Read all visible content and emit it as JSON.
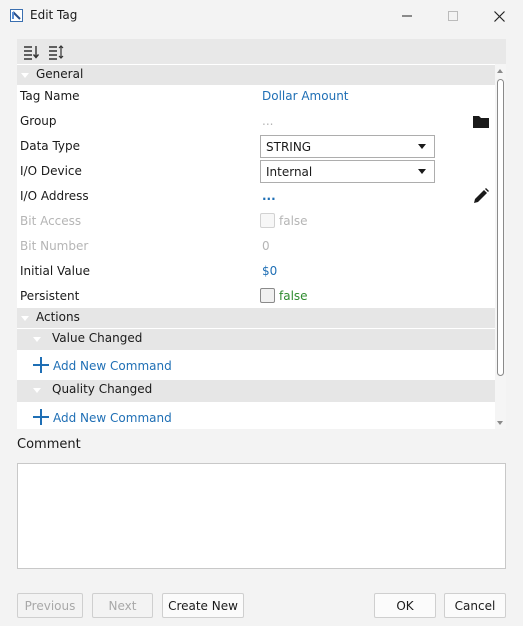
{
  "window": {
    "title": "Edit Tag"
  },
  "toolbar": {
    "icons": [
      "sort-ascending-icon",
      "sort-options-icon"
    ]
  },
  "sections": {
    "general": "General",
    "actions": "Actions",
    "value_changed": "Value Changed",
    "quality_changed": "Quality Changed"
  },
  "properties": {
    "tag_name": {
      "label": "Tag Name",
      "value": "Dollar Amount"
    },
    "group": {
      "label": "Group",
      "value": "..."
    },
    "data_type": {
      "label": "Data Type",
      "value": "STRING"
    },
    "io_device": {
      "label": "I/O Device",
      "value": "Internal"
    },
    "io_address": {
      "label": "I/O Address",
      "value": "..."
    },
    "bit_access": {
      "label": "Bit Access",
      "value": "false"
    },
    "bit_number": {
      "label": "Bit Number",
      "value": "0"
    },
    "initial_value": {
      "label": "Initial Value",
      "value": "$0"
    },
    "persistent": {
      "label": "Persistent",
      "value": "false"
    }
  },
  "actions": {
    "value_changed_add": "Add New Command",
    "quality_changed_add": "Add New Command"
  },
  "comment": {
    "label": "Comment",
    "value": ""
  },
  "buttons": {
    "previous": "Previous",
    "next": "Next",
    "create_new": "Create New",
    "ok": "OK",
    "cancel": "Cancel"
  },
  "colors": {
    "link_blue": "#1f6fb5",
    "false_green": "#2e8b2e",
    "section_bg": "#e6e6e6"
  }
}
